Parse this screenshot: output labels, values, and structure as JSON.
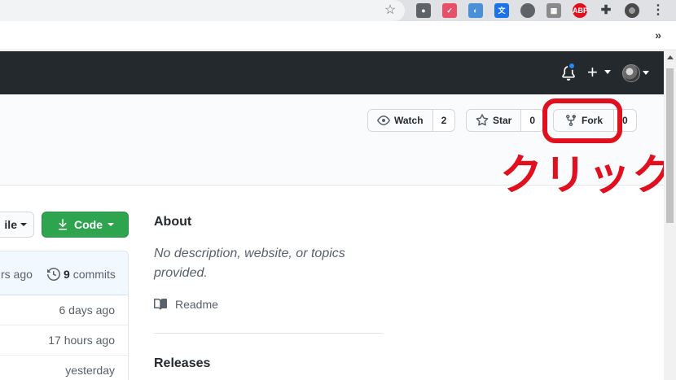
{
  "browser": {
    "extensions": [
      {
        "name": "lightbulb-extension-icon",
        "bg": "#5f6368",
        "label": ""
      },
      {
        "name": "calendar-extension-icon",
        "bg": "#e8506a",
        "label": ""
      },
      {
        "name": "palette-extension-icon",
        "bg": "#4a90d9",
        "label": ""
      },
      {
        "name": "translate-extension-icon",
        "bg": "#1a73e8",
        "label": ""
      },
      {
        "name": "circle-extension-icon",
        "bg": "#5f6368",
        "label": ""
      },
      {
        "name": "board-extension-icon",
        "bg": "#8a8a8a",
        "label": ""
      },
      {
        "name": "adblock-extension-icon",
        "bg": "#e0101e",
        "label": "ABP"
      },
      {
        "name": "puzzle-extension-icon",
        "bg": "#3c4043",
        "label": ""
      }
    ],
    "bookmarks_more": "»",
    "menu_icon": "⋮"
  },
  "header": {
    "plus": "+"
  },
  "repo_actions": {
    "watch_label": "Watch",
    "watch_count": "2",
    "star_label": "Star",
    "star_count": "0",
    "fork_label": "Fork",
    "fork_count": "0"
  },
  "annotation": {
    "text": "クリック",
    "color": "#e0101e"
  },
  "file_nav": {
    "go_to_file_partial": "ile",
    "code_label": "Code"
  },
  "commits": {
    "last_commit_partial": "rs ago",
    "count": "9",
    "count_label": "commits"
  },
  "file_rows": [
    {
      "age": "6 days ago"
    },
    {
      "age": "17 hours ago"
    },
    {
      "age": "yesterday"
    }
  ],
  "about": {
    "title": "About",
    "description": "No description, website, or topics provided.",
    "readme_label": "Readme",
    "releases_title": "Releases"
  },
  "colors": {
    "header_bg": "#24292e",
    "code_button": "#2ea44f",
    "annotation_red": "#e0101e"
  }
}
